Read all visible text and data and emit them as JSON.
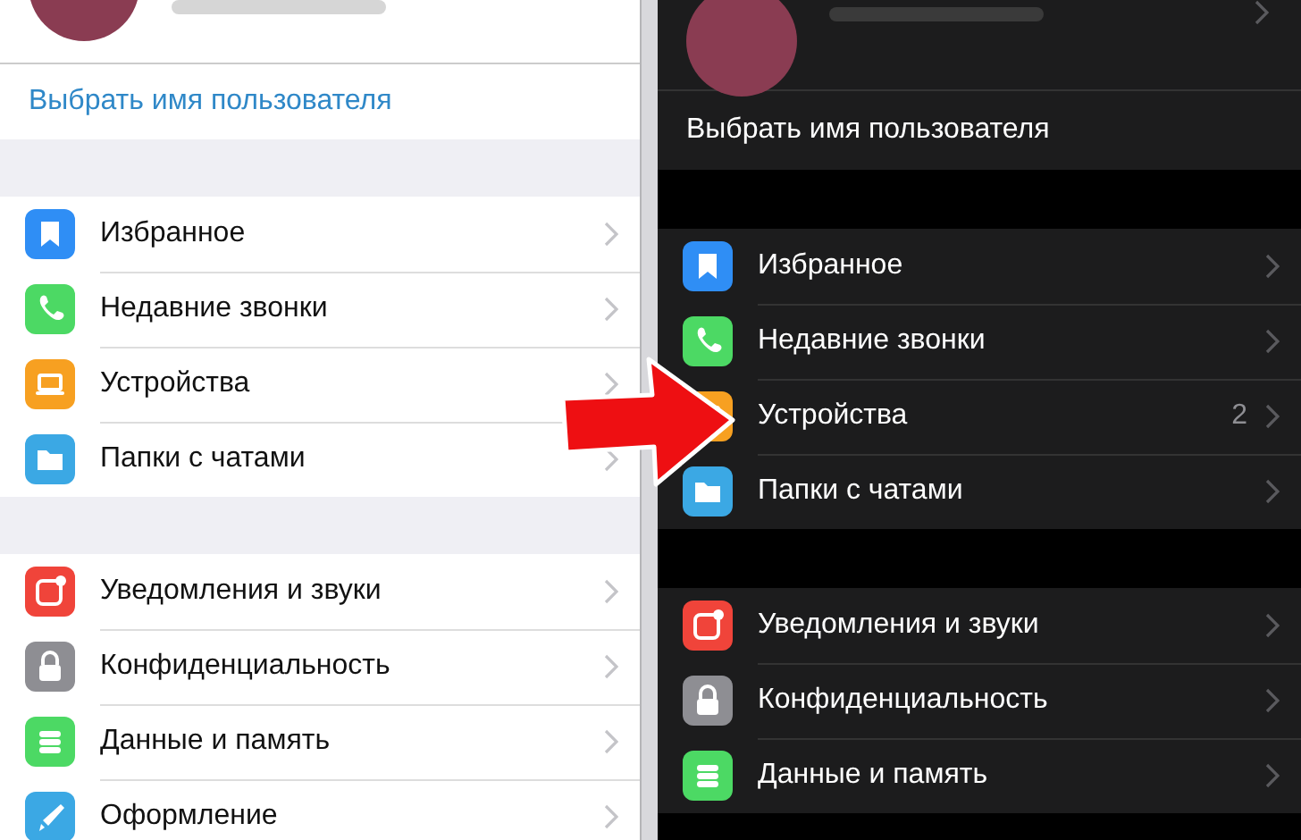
{
  "panels": [
    {
      "kind": "light",
      "profile": {
        "chevron": false
      },
      "username_link": "Выбрать имя пользователя",
      "groups": [
        [
          {
            "kind": "bookmark",
            "color": "#2f8ef5",
            "label": "Избранное"
          },
          {
            "kind": "phone",
            "color": "#4cd964",
            "label": "Недавние звонки"
          },
          {
            "kind": "laptop",
            "color": "#f7a021",
            "label": "Устройства"
          },
          {
            "kind": "folder",
            "color": "#3ba8e4",
            "label": "Папки с чатами"
          }
        ],
        [
          {
            "kind": "bell",
            "color": "#f0443a",
            "label": "Уведомления и звуки"
          },
          {
            "kind": "lock",
            "color": "#8e8e93",
            "label": "Конфиденциальность"
          },
          {
            "kind": "database",
            "color": "#4cd964",
            "label": "Данные и память"
          },
          {
            "kind": "brush",
            "color": "#3ba8e4",
            "label": "Оформление"
          }
        ]
      ]
    },
    {
      "kind": "dark",
      "profile": {
        "chevron": true
      },
      "username_link": "Выбрать имя пользователя",
      "groups": [
        [
          {
            "kind": "bookmark",
            "color": "#2f8ef5",
            "label": "Избранное"
          },
          {
            "kind": "phone",
            "color": "#4cd964",
            "label": "Недавние звонки"
          },
          {
            "kind": "laptop",
            "color": "#f7a021",
            "label": "Устройства",
            "badge": "2"
          },
          {
            "kind": "folder",
            "color": "#3ba8e4",
            "label": "Папки с чатами"
          }
        ],
        [
          {
            "kind": "bell",
            "color": "#f0443a",
            "label": "Уведомления и звуки"
          },
          {
            "kind": "lock",
            "color": "#8e8e93",
            "label": "Конфиденциальность"
          },
          {
            "kind": "database",
            "color": "#4cd964",
            "label": "Данные и память"
          }
        ]
      ]
    }
  ]
}
